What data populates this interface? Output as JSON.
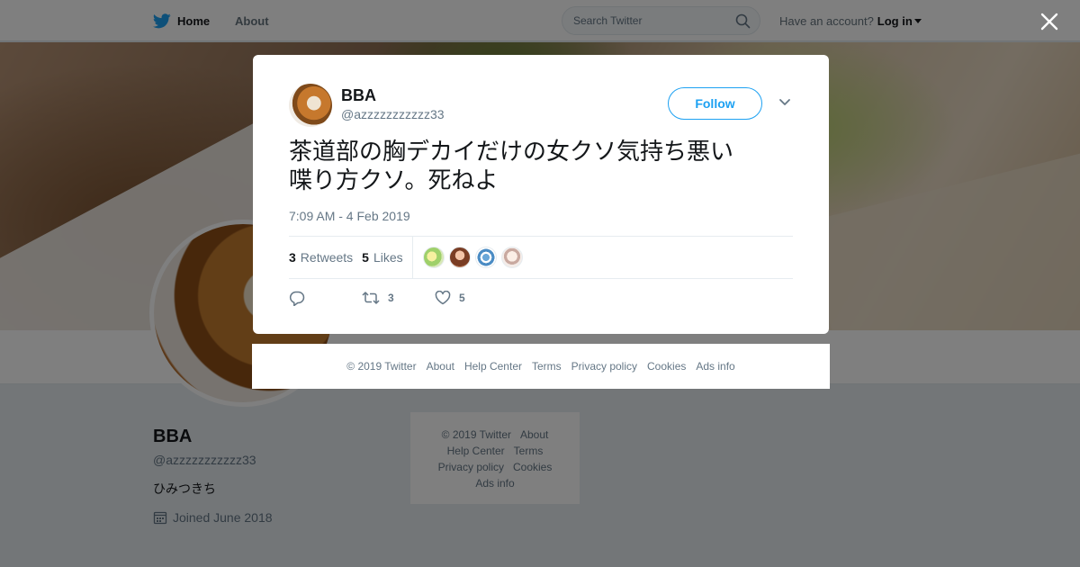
{
  "nav": {
    "home_label": "Home",
    "about_label": "About",
    "search_placeholder": "Search Twitter",
    "have_account": "Have an account?",
    "login_label": "Log in"
  },
  "profile": {
    "name": "BBA",
    "handle": "@azzzzzzzzzzz33",
    "bio": "ひみつきち",
    "joined": "Joined June 2018"
  },
  "side_footer": {
    "copyright": "© 2019 Twitter",
    "links": [
      "About",
      "Help Center",
      "Terms",
      "Privacy policy",
      "Cookies",
      "Ads info"
    ]
  },
  "tweet": {
    "author_name": "BBA",
    "author_handle": "@azzzzzzzzzzz33",
    "follow_label": "Follow",
    "text_line1": "茶道部の胸デカイだけの女クソ気持ち悪い",
    "text_line2": "喋り方クソ。死ねよ",
    "timestamp": "7:09 AM - 4 Feb 2019",
    "retweets_count": "3",
    "retweets_label": "Retweets",
    "likes_count": "5",
    "likes_label": "Likes",
    "reply_count": "",
    "retweet_action_count": "3",
    "like_action_count": "5"
  },
  "modal_footer": {
    "copyright": "© 2019 Twitter",
    "links": [
      "About",
      "Help Center",
      "Terms",
      "Privacy policy",
      "Cookies",
      "Ads info"
    ]
  },
  "colors": {
    "brand": "#1da1f2",
    "text_secondary": "#657786",
    "overlay": "rgba(0,0,0,0.5)"
  },
  "icons": [
    "twitter-bird-icon",
    "search-icon",
    "caret-down-icon",
    "close-icon",
    "chevron-down-icon",
    "calendar-icon",
    "reply-icon",
    "retweet-icon",
    "like-icon"
  ]
}
